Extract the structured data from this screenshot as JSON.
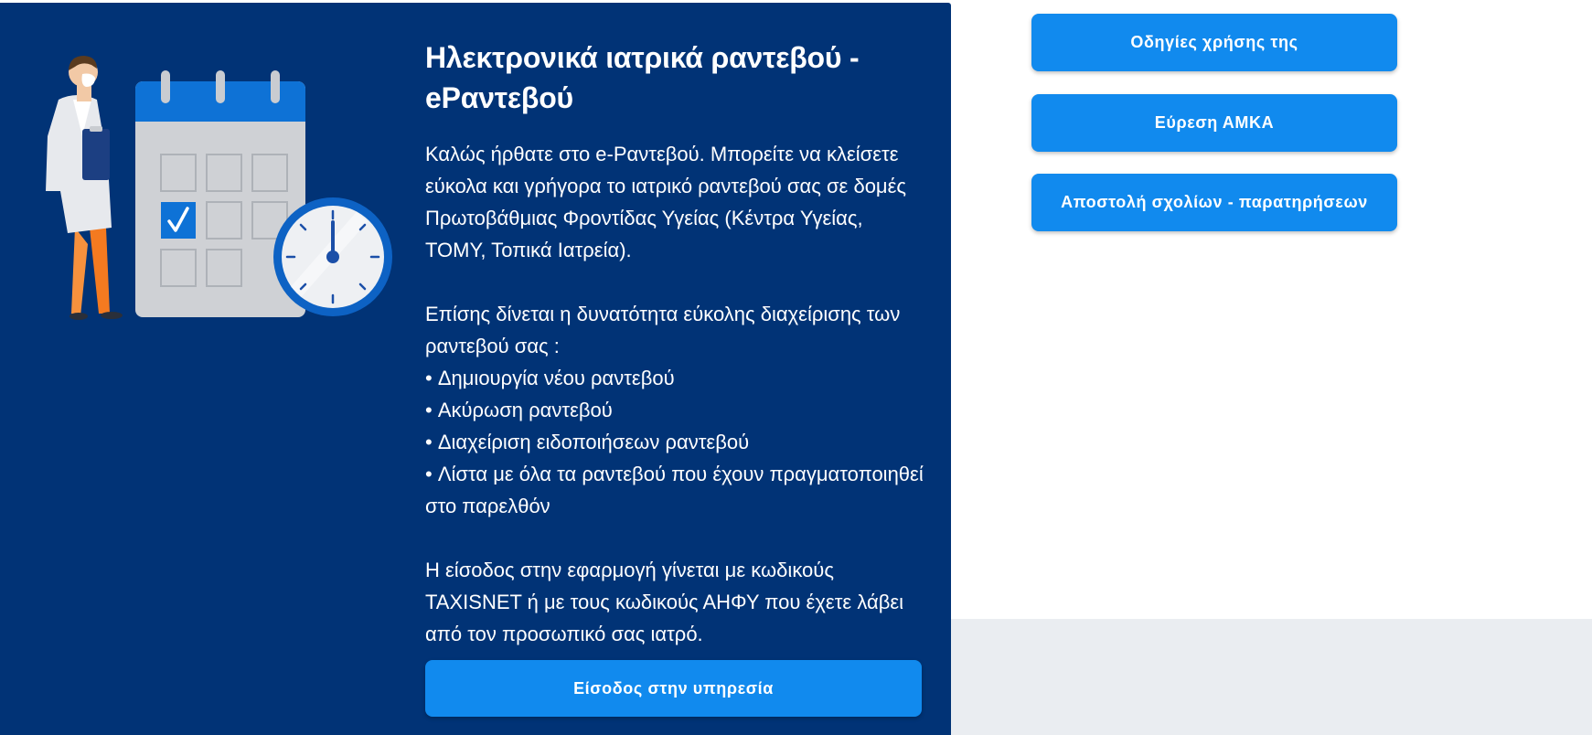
{
  "hero": {
    "title": "Ηλεκτρονικά ιατρικά ραντεβού - eΡαντεβού",
    "intro": "Καλώς ήρθατε στο e-Ραντεβού. Μπορείτε να κλείσετε εύκολα και γρήγορα το ιατρικό ραντεβού σας σε δομές Πρωτοβάθμιας Φροντίδας Υγείας (Κέντρα Υγείας, ΤΟΜΥ, Τοπικά Ιατρεία).",
    "manage_intro": "Επίσης δίνεται η δυνατότητα εύκολης διαχείρισης των ραντεβού σας :",
    "features": [
      "Δημιουργία νέου ραντεβού",
      "Ακύρωση ραντεβού",
      "Διαχείριση ειδοποιήσεων ραντεβού",
      "Λίστα με όλα τα ραντεβού που έχουν πραγματοποιηθεί στο παρελθόν"
    ],
    "login_note": "Η είσοδος στην εφαρμογή γίνεται με κωδικούς TAXISNET ή με τους κωδικούς ΑΗΦΥ που έχετε λάβει από τον προσωπικό σας ιατρό.",
    "login_button": "Είσοδος στην υπηρεσία"
  },
  "side_links": {
    "instructions": "Οδηγίες χρήσης της",
    "find_amka": "Εύρεση ΑΜΚΑ",
    "send_feedback": "Αποστολή σχολίων - παρατηρήσεων"
  },
  "colors": {
    "panel_background": "#013376",
    "button_blue": "#118aee",
    "footer_gray": "#eaedf1"
  },
  "illustration": {
    "icons": [
      "doctor-figure",
      "calendar-icon",
      "clock-icon",
      "checkmark-icon"
    ]
  }
}
